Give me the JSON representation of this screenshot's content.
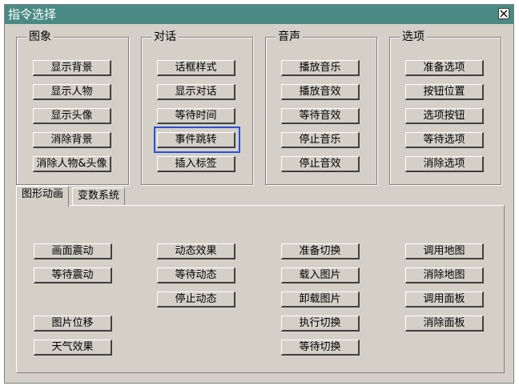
{
  "window": {
    "title": "指令选择",
    "close_icon": "close-icon"
  },
  "groups": [
    {
      "label": "图象",
      "buttons": [
        "显示背景",
        "显示人物",
        "显示头像",
        "消除背景",
        "消除人物&头像"
      ]
    },
    {
      "label": "对话",
      "buttons": [
        "话框样式",
        "显示对话",
        "等待时间",
        "事件跳转",
        "插入标签"
      ]
    },
    {
      "label": "音声",
      "buttons": [
        "播放音乐",
        "播放音效",
        "等待音效",
        "停止音乐",
        "停止音效"
      ]
    },
    {
      "label": "选项",
      "buttons": [
        "准备选项",
        "按钮位置",
        "选项按钮",
        "等待选项",
        "消除选项"
      ]
    }
  ],
  "focused_button": "事件跳转",
  "tabs": [
    {
      "label": "图形动画",
      "active": true
    },
    {
      "label": "变数系统",
      "active": false
    }
  ],
  "tab_buttons": {
    "col1": [
      "画面震动",
      "等待震动",
      "图片位移",
      "天气效果"
    ],
    "col2": [
      "动态效果",
      "等待动态",
      "停止动态"
    ],
    "col3": [
      "准备切换",
      "载入图片",
      "卸载图片",
      "执行切换",
      "等待切换"
    ],
    "col4": [
      "调用地图",
      "消除地图",
      "调用面板",
      "消除面板"
    ]
  },
  "colors": {
    "titlebar": "#4a8a84",
    "face": "#d4d0c8",
    "focus": "#2a4fd8"
  }
}
